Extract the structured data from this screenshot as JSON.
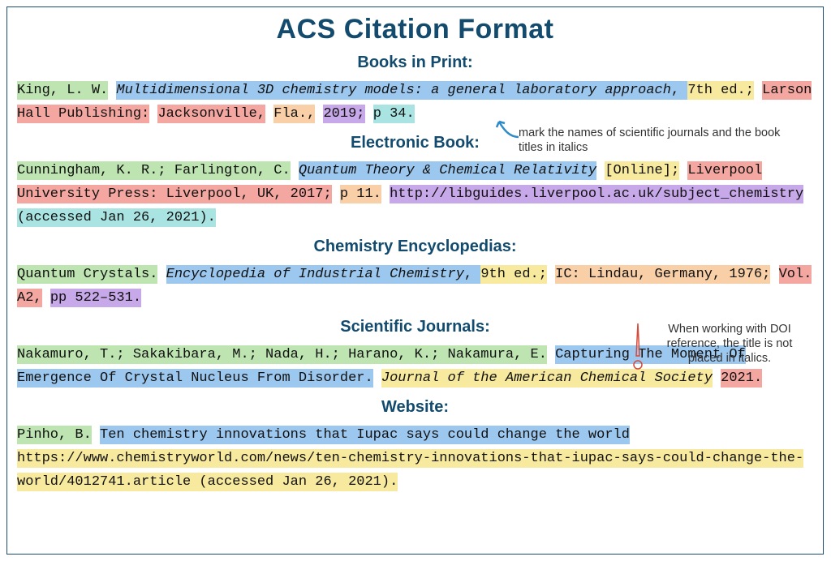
{
  "title": "ACS Citation Format",
  "sections": {
    "books_print": {
      "heading": "Books in Print:",
      "parts": {
        "author": "King, L. W.",
        "book_title": "Multidimensional 3D chemistry models: a general laboratory approach",
        "comma1": ", ",
        "edition": "7th ed.;",
        "publisher": "Larson Hall Publishing:",
        "city": "Jacksonville,",
        "state": "Fla.,",
        "year": "2019;",
        "page": "p 34."
      }
    },
    "electronic_book": {
      "heading": "Electronic Book:",
      "parts": {
        "authors": "Cunningham, K. R.; Farlington, C.",
        "book_title": "Quantum Theory & Chemical Relativity",
        "online": "[Online];",
        "publisher": "Liverpool University Press: Liverpool, UK, 2017;",
        "page": "p 11.",
        "url": "http://libguides.liverpool.ac.uk/subject_chemistry",
        "accessed": "(accessed Jan 26, 2021)."
      }
    },
    "encyclopedias": {
      "heading": "Chemistry Encyclopedias:",
      "parts": {
        "entry": "Quantum Crystals.",
        "enc_title": "Encyclopedia of Industrial Chemistry",
        "comma1": ", ",
        "edition": "9th ed.;",
        "publisher": "IC: Lindau, Germany, 1976;",
        "vol": "Vol. A2,",
        "pages": "pp 522–531."
      }
    },
    "journals": {
      "heading": "Scientific Journals:",
      "parts": {
        "authors": "Nakamuro, T.; Sakakibara, M.; Nada, H.; Harano, K.; Nakamura, E.",
        "article_title": "Capturing The Moment Of Emergence Of Crystal Nucleus From Disorder.",
        "journal": "Journal of the American Chemical Society",
        "year": "2021."
      }
    },
    "website": {
      "heading": "Website:",
      "parts": {
        "author": "Pinho, B.",
        "page_title": "Ten chemistry innovations that Iupac says could change the world",
        "url_accessed": "https://www.chemistryworld.com/news/ten-chemistry-innovations-that-iupac-says-could-change-the-world/4012741.article (accessed Jan 26, 2021)."
      }
    }
  },
  "annotations": {
    "italics_note": "mark the names of scientific journals and the book titles in italics",
    "doi_note": "When working with DOI reference, the title is not placed in italics."
  },
  "colors": {
    "heading": "#124b6e",
    "arrow": "#2f8ac9",
    "exclaim": "#d64a3a"
  }
}
